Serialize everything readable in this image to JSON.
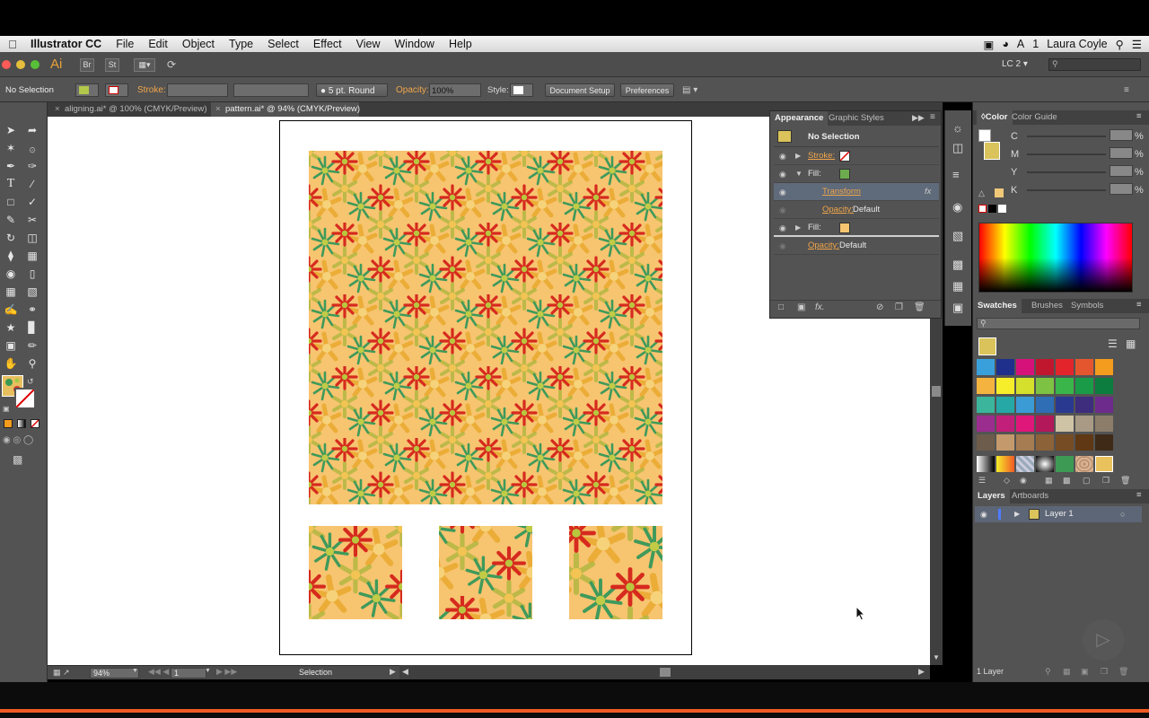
{
  "menubar": {
    "app_name": "Illustrator CC",
    "items": [
      "File",
      "Edit",
      "Object",
      "Type",
      "Select",
      "Effect",
      "View",
      "Window",
      "Help"
    ],
    "user": "Laura Coyle",
    "notification_count": "1"
  },
  "appbar": {
    "app_icon": "Ai",
    "bridge_label": "Br",
    "stock_label": "St",
    "workspace": "LC 2"
  },
  "control": {
    "selection": "No Selection",
    "stroke_label": "Stroke:",
    "brush": "5 pt. Round",
    "opacity_label": "Opacity:",
    "opacity_value": "100%",
    "style_label": "Style:",
    "doc_setup": "Document Setup",
    "preferences": "Preferences"
  },
  "tabs": [
    {
      "label": "aligning.ai* @ 100% (CMYK/Preview)"
    },
    {
      "label": "pattern.ai* @ 94% (CMYK/Preview)"
    }
  ],
  "status": {
    "zoom": "94%",
    "artboard": "1",
    "tool": "Selection"
  },
  "appearance": {
    "tabs": [
      "Appearance",
      "Graphic Styles"
    ],
    "title": "No Selection",
    "rows": [
      {
        "label": "Stroke:"
      },
      {
        "label": "Fill:"
      },
      {
        "label": "Transform"
      },
      {
        "label": "Opacity:",
        "value": "Default"
      },
      {
        "label": "Fill:"
      },
      {
        "label": "Opacity:",
        "value": "Default"
      }
    ],
    "fx": "fx"
  },
  "color": {
    "tabs": [
      "Color",
      "Color Guide"
    ],
    "channels": [
      "C",
      "M",
      "Y",
      "K"
    ],
    "unit": "%"
  },
  "swatches": {
    "tabs": [
      "Swatches",
      "Brushes",
      "Symbols"
    ],
    "colors": [
      "#3aa0dc",
      "#1e2f8c",
      "#d6117a",
      "#c0172f",
      "#e3242b",
      "#e4572e",
      "#f39c1d",
      "#f4b33f",
      "#f6ee2a",
      "#d4e02b",
      "#7dc242",
      "#39b54a",
      "#1a9b48",
      "#0d7d3f",
      "#3bb59b",
      "#25a8a6",
      "#3b9bd4",
      "#2f6db5",
      "#2a3990",
      "#3e2c7c",
      "#6d2b8c",
      "#9b2d8e",
      "#c11f7a",
      "#e0177a",
      "#b2185a",
      "#cec3a4",
      "#a89a84",
      "#8c7d6a",
      "#6d5c4b",
      "#c49a6c",
      "#a67c52",
      "#8c6239",
      "#754c24",
      "#603813",
      "#3f2a17"
    ]
  },
  "layers": {
    "tabs": [
      "Layers",
      "Artboards"
    ],
    "layer_name": "Layer 1",
    "count": "1 Layer"
  }
}
